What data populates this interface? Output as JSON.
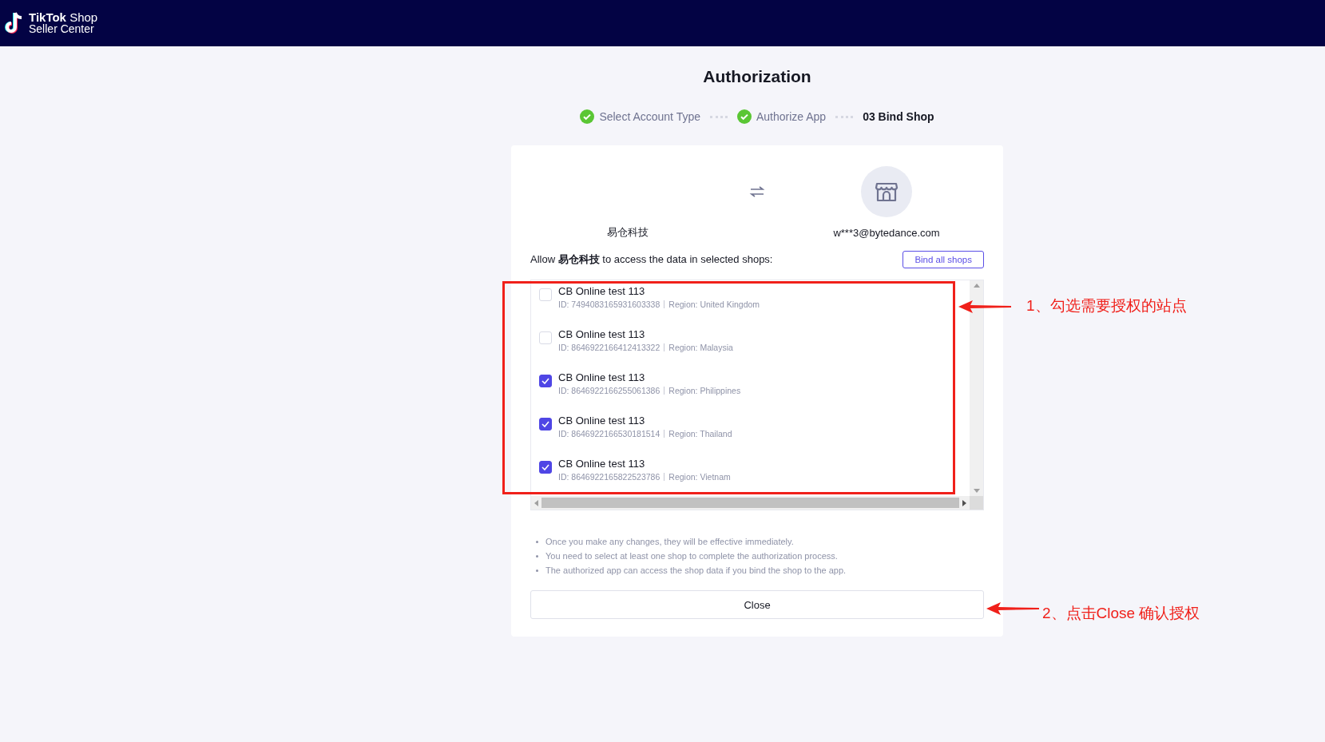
{
  "header": {
    "brand": "TikTok",
    "product": "Shop",
    "subtitle": "Seller Center"
  },
  "page_title": "Authorization",
  "steps": [
    {
      "label": "Select Account Type",
      "done": true
    },
    {
      "label": "Authorize App",
      "done": true
    },
    {
      "label": "03 Bind Shop",
      "done": false
    }
  ],
  "card": {
    "app_name": "易仓科技",
    "account": "w***3@bytedance.com",
    "allow_text": "Allow **易仓科技** to access the data in selected shops:",
    "bind_all_button": "Bind all shops",
    "shops": [
      {
        "name": "CB Online test 113",
        "id": "ID: 7494083165931603338",
        "region": "Region: United Kingdom",
        "checked": false
      },
      {
        "name": "CB Online test 113",
        "id": "ID: 8646922166412413322",
        "region": "Region: Malaysia",
        "checked": false
      },
      {
        "name": "CB Online test 113",
        "id": "ID: 8646922166255061386",
        "region": "Region: Philippines",
        "checked": true
      },
      {
        "name": "CB Online test 113",
        "id": "ID: 8646922166530181514",
        "region": "Region: Thailand",
        "checked": true
      },
      {
        "name": "CB Online test 113",
        "id": "ID: 8646922165822523786",
        "region": "Region: Vietnam",
        "checked": true
      }
    ],
    "notes": [
      "Once you make any changes, they will be effective immediately.",
      "You need to select at least one shop to complete the authorization process.",
      "The authorized app can access the shop data if you bind the shop to the app."
    ],
    "close_button": "Close"
  },
  "annotations": [
    {
      "text": "1、勾选需要授权的站点"
    },
    {
      "text": "2、点击Close 确认授权"
    }
  ]
}
